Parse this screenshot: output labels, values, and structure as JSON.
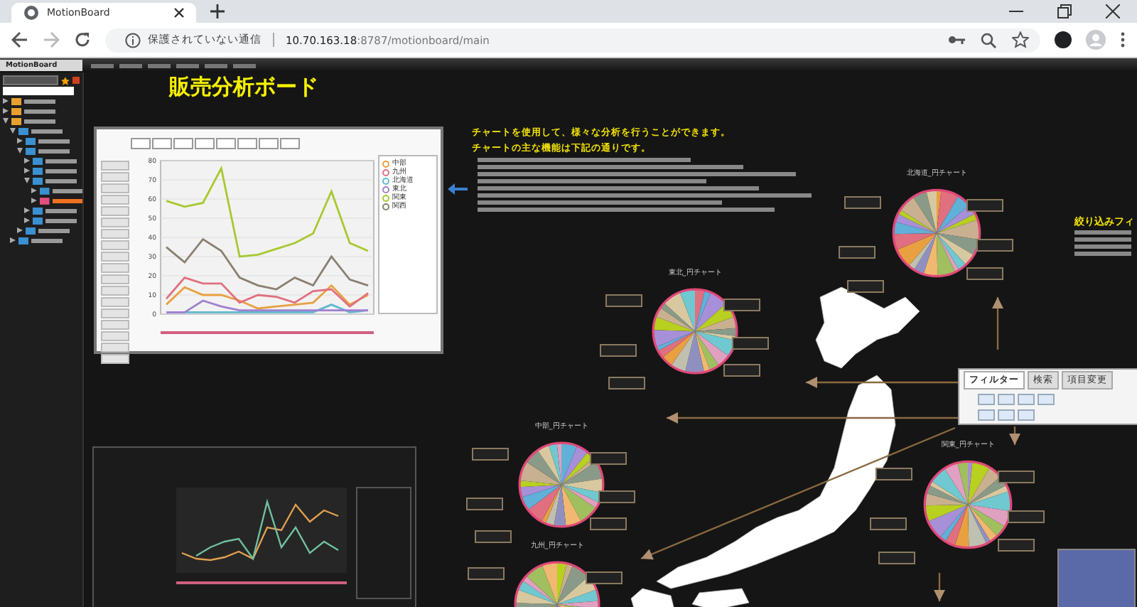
{
  "browser": {
    "tab_title": "MotionBoard",
    "security_label": "保護されていない通信",
    "url_host": "10.70.163.18",
    "url_path": ":8787/motionboard/main"
  },
  "app": {
    "logo": "MotionBoard"
  },
  "sidebar": {
    "items": [
      {
        "selected": false,
        "expanded": false
      },
      {
        "selected": false,
        "expanded": false
      },
      {
        "selected": false,
        "expanded": true,
        "children": [
          {
            "selected": false,
            "expanded": true,
            "children": [
              {
                "selected": false,
                "expanded": false
              },
              {
                "selected": false,
                "expanded": true,
                "children": [
                  {
                    "selected": false,
                    "expanded": false
                  },
                  {
                    "selected": false,
                    "expanded": false
                  },
                  {
                    "selected": false,
                    "expanded": true,
                    "children": [
                      {
                        "selected": false,
                        "expanded": false
                      },
                      {
                        "selected": true,
                        "expanded": false
                      }
                    ]
                  },
                  {
                    "selected": false,
                    "expanded": false
                  },
                  {
                    "selected": false,
                    "expanded": false
                  }
                ]
              },
              {
                "selected": false,
                "expanded": false
              }
            ]
          },
          {
            "selected": false,
            "expanded": false
          }
        ]
      }
    ]
  },
  "board": {
    "title": "販売分析ボード",
    "description": [
      "チャートを使用して、様々な分析を行うことができます。",
      "チャートの主な機能は下記の通りです。"
    ],
    "side_note": "絞り込みフィ",
    "line_chart": {
      "chart_data": {
        "type": "line",
        "grid": true,
        "ylim": [
          0,
          80
        ],
        "yticks": [
          0,
          10,
          20,
          30,
          40,
          50,
          60,
          70,
          80
        ],
        "series": [
          {
            "name": "中部",
            "color": "#e8a040",
            "values": [
              5,
              14,
              10,
              10,
              7,
              3,
              4,
              5,
              6,
              15,
              5,
              10
            ]
          },
          {
            "name": "九州",
            "color": "#e07080",
            "values": [
              8,
              19,
              16,
              16,
              6,
              10,
              9,
              6,
              12,
              13,
              4,
              11
            ]
          },
          {
            "name": "北海道",
            "color": "#60b8d0",
            "values": [
              1,
              1,
              1,
              1,
              1,
              1,
              1,
              1,
              1,
              5,
              1,
              2
            ]
          },
          {
            "name": "東北",
            "color": "#a080d0",
            "values": [
              1,
              1,
              7,
              4,
              2,
              2,
              2,
              2,
              2,
              2,
              2,
              2
            ]
          },
          {
            "name": "関東",
            "color": "#a8c830",
            "values": [
              59,
              56,
              58,
              76,
              30,
              31,
              34,
              37,
              42,
              64,
              37,
              33
            ]
          },
          {
            "name": "関西",
            "color": "#8a8070",
            "values": [
              35,
              27,
              39,
              33,
              19,
              15,
              13,
              19,
              15,
              30,
              18,
              15
            ]
          }
        ]
      }
    },
    "pies": [
      {
        "title": "北海道_円チャート"
      },
      {
        "title": "東北_円チャート"
      },
      {
        "title": "中部_円チャート"
      },
      {
        "title": "関東_円チャート"
      },
      {
        "title": "九州_円チャート"
      }
    ],
    "filter_panel": {
      "tabs": [
        {
          "label": "フィルター",
          "selected": true
        },
        {
          "label": "検索",
          "selected": false
        },
        {
          "label": "項目変更",
          "selected": false
        }
      ]
    }
  }
}
